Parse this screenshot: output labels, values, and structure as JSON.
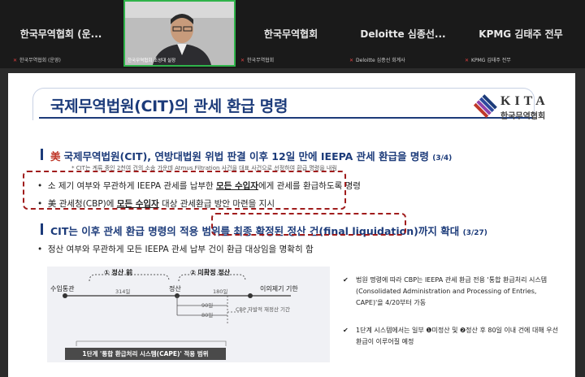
{
  "participants": [
    {
      "name": "한국무역협회 (운...",
      "tag": "한국무역협회 (운영)"
    },
    {
      "name": "한국무역협회",
      "tag": "한국무역협회"
    },
    {
      "name": "Deloitte 심종선...",
      "tag": "Deloitte 심종선 회계사"
    },
    {
      "name": "KPMG 김태주 전무",
      "tag": "KPMG 김태주 전무"
    }
  ],
  "video_tag": "한국무역협회 조성대 실장",
  "slide": {
    "title": "국제무역법원(CIT)의 관세 환급 명령",
    "logo_word": "KITA",
    "logo_sub": "한국무역협회",
    "h1_mark": "美",
    "h1_text": "국제무역법원(CIT), 연방대법원 위법 판결 이후 12일 만에 IEEPA 관세 환급을 명령",
    "h1_date": "(3/4)",
    "note": "* CIT는 계류 중인 2천여 건의 소송 가운데 Atmus Filtration 사건을 대표 사건으로 선정하여 환급 명령을 내림",
    "b1_pre": "소 제기 여부와 무관하게 IEEPA 관세를 납부한 ",
    "b1_u": "모든 수입자",
    "b1_post": "에게 관세를 환급하도록 명령",
    "b2_pre": "美 관세청(CBP)에 ",
    "b2_u": "모든 수입자",
    "b2_post": " 대상 관세환급 방안 마련을 지시",
    "h2_text": "CIT는 이후 관세 환급 명령의 적용 범위를 최종 확정된 정산 건(final liquidation)까지 확대",
    "h2_date": "(3/27)",
    "sub_bullet": "정산 여부와 무관하게 모든 IEEPA 관세 납부 건이 환급 대상임을 명확히 함"
  },
  "diagram": {
    "stage1": "① 정산 前",
    "stage2": "② 미확정 정산",
    "import": "수입통관",
    "d314": "314일",
    "settle": "정산",
    "d180": "180일",
    "protest": "이의제기 기한",
    "d90": "90일",
    "d80": "80일",
    "cbp_period": "CBP 자발적 재정산 기간",
    "cape": "1단계 '통합 환급처리 시스템(CAPE)' 적용 범위"
  },
  "side_notes": [
    {
      "check": "✔",
      "text": "법원 명령에 따라 CBP는 IEEPA 관세 환급 전용 '통합 환급처리 시스템(Consolidated Administration and Processing of Entries, CAPE)'을 4/20부터 가동"
    },
    {
      "check": "✔",
      "text": "1단계 시스템에서는 일부 ❶미정산 및 ❷정산 후 80일 이내 건에 대해 우선 환급이 이루어질 예정"
    }
  ],
  "colors": {
    "accent": "#1c3b7a",
    "highlight": "#a01c1c",
    "active_speaker": "#2fb34a"
  }
}
